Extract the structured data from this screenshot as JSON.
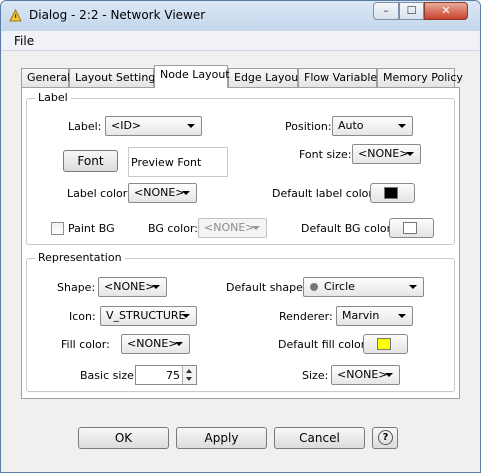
{
  "window": {
    "title": "Dialog - 2:2 - Network Viewer",
    "min_glyph": "–",
    "max_glyph": "☐",
    "close_glyph": "✕"
  },
  "menu": {
    "file": "File"
  },
  "tabs": [
    {
      "label": "General"
    },
    {
      "label": "Layout Settings"
    },
    {
      "label": "Node Layout",
      "active": true
    },
    {
      "label": "Edge Layout"
    },
    {
      "label": "Flow Variables"
    },
    {
      "label": "Memory Policy"
    }
  ],
  "label_group": {
    "title": "Label",
    "label_label": "Label:",
    "label_value": "<ID>",
    "position_label": "Position:",
    "position_value": "Auto",
    "font_button": "Font",
    "preview_text": "Preview Font",
    "font_size_label": "Font size:",
    "font_size_value": "<NONE>",
    "label_color_label": "Label color:",
    "label_color_value": "<NONE>",
    "default_label_color_label": "Default label color:",
    "default_label_color": "#000000",
    "paint_bg_label": "Paint BG",
    "paint_bg_checked": false,
    "bg_color_label": "BG color:",
    "bg_color_value": "<NONE>",
    "default_bg_color_label": "Default BG color:",
    "default_bg_color": "#ffffff"
  },
  "representation_group": {
    "title": "Representation",
    "shape_label": "Shape:",
    "shape_value": "<NONE>",
    "default_shape_label": "Default shape:",
    "default_shape_value": "Circle",
    "icon_label": "Icon:",
    "icon_value": "V_STRUCTURE",
    "renderer_label": "Renderer:",
    "renderer_value": "Marvin",
    "fill_color_label": "Fill color:",
    "fill_color_value": "<NONE>",
    "default_fill_color_label": "Default fill color:",
    "default_fill_color": "#ffff00",
    "basic_size_label": "Basic size:",
    "basic_size_value": "75",
    "size_label": "Size:",
    "size_value": "<NONE>"
  },
  "buttons": {
    "ok": "OK",
    "apply": "Apply",
    "cancel": "Cancel",
    "help_glyph": "?"
  }
}
